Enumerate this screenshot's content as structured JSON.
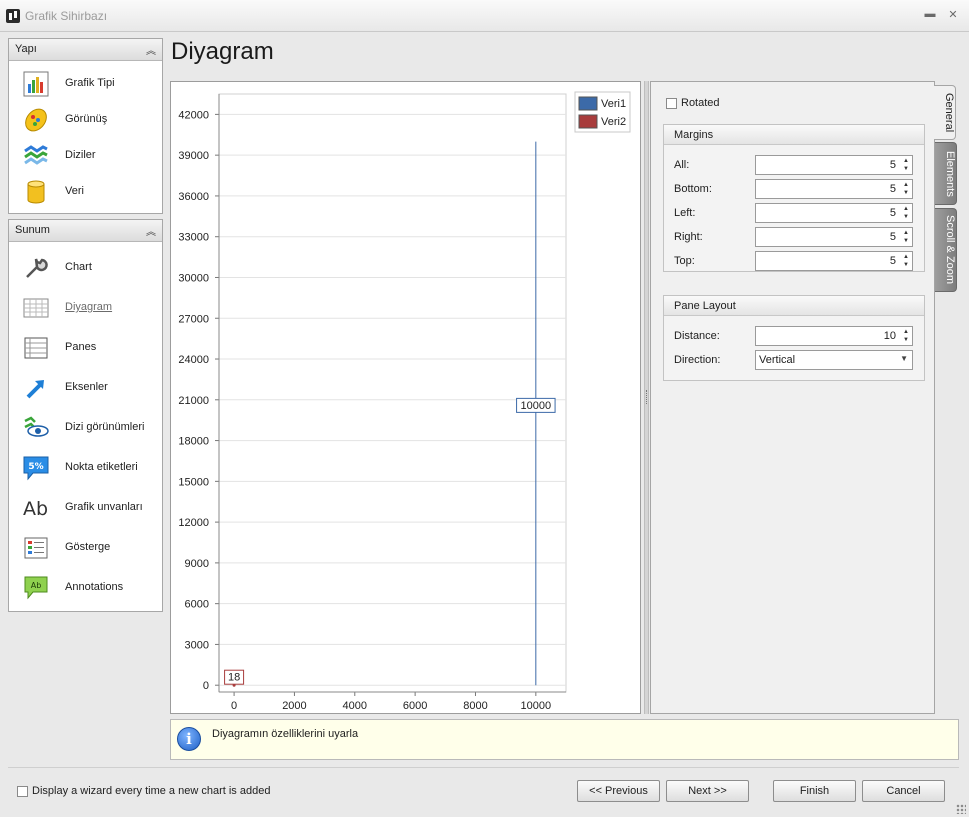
{
  "window": {
    "title": "Grafik Sihirbazı"
  },
  "sidebar": {
    "group1": {
      "title": "Yapı",
      "items": [
        {
          "label": "Grafik Tipi",
          "icon": "bar-chart-icon"
        },
        {
          "label": "Görünüş",
          "icon": "palette-icon"
        },
        {
          "label": "Diziler",
          "icon": "series-stack-icon"
        },
        {
          "label": "Veri",
          "icon": "database-cylinder-icon"
        }
      ]
    },
    "group2": {
      "title": "Sunum",
      "items": [
        {
          "label": "Chart",
          "icon": "wrench-icon"
        },
        {
          "label": "Diyagram",
          "icon": "diagram-grid-icon",
          "active": true
        },
        {
          "label": "Panes",
          "icon": "panes-icon"
        },
        {
          "label": "Eksenler",
          "icon": "axis-arrow-icon"
        },
        {
          "label": "Dizi görünümleri",
          "icon": "series-view-eye-icon"
        },
        {
          "label": "Nokta etiketleri",
          "icon": "point-label-percent-icon"
        },
        {
          "label": "Grafik unvanları",
          "icon": "title-ab-icon"
        },
        {
          "label": "Gösterge",
          "icon": "legend-list-icon"
        },
        {
          "label": "Annotations",
          "icon": "annotation-callout-icon"
        }
      ]
    }
  },
  "page": {
    "title": "Diyagram"
  },
  "chart_data": {
    "type": "line",
    "legend": [
      "Veri1",
      "Veri2"
    ],
    "legend_colors": [
      "#3c6aa8",
      "#a83c3c"
    ],
    "legend_position": "top-right",
    "x_ticks": [
      "0",
      "2000",
      "4000",
      "6000",
      "8000",
      "10000"
    ],
    "y_ticks": [
      "0",
      "3000",
      "6000",
      "9000",
      "12000",
      "15000",
      "18000",
      "21000",
      "24000",
      "27000",
      "30000",
      "33000",
      "36000",
      "39000",
      "42000"
    ],
    "xlim": [
      -500,
      11000
    ],
    "ylim": [
      -500,
      43500
    ],
    "grid": true,
    "series": [
      {
        "name": "Veri1",
        "color": "#3c6aa8",
        "points": [
          [
            10000,
            0
          ],
          [
            10000,
            40000
          ]
        ],
        "label": "10000",
        "label_at": [
          10000,
          20000
        ]
      },
      {
        "name": "Veri2",
        "color": "#a83c3c",
        "points": [
          [
            0,
            0
          ]
        ],
        "label": "18",
        "label_at": [
          0,
          0
        ]
      }
    ]
  },
  "properties": {
    "rotated_label": "Rotated",
    "margins": {
      "title": "Margins",
      "rows": [
        {
          "label": "All:",
          "value": "5"
        },
        {
          "label": "Bottom:",
          "value": "5"
        },
        {
          "label": "Left:",
          "value": "5"
        },
        {
          "label": "Right:",
          "value": "5"
        },
        {
          "label": "Top:",
          "value": "5"
        }
      ]
    },
    "pane_layout": {
      "title": "Pane Layout",
      "distance_label": "Distance:",
      "distance_value": "10",
      "direction_label": "Direction:",
      "direction_value": "Vertical"
    },
    "tabs": [
      "General",
      "Elements",
      "Scroll & Zoom"
    ]
  },
  "hint": {
    "text": "Diyagramın özelliklerini uyarla"
  },
  "footer": {
    "checkbox_label": "Display a wizard every time a new chart is added",
    "buttons": {
      "previous": "<< Previous",
      "next": "Next >>",
      "finish": "Finish",
      "cancel": "Cancel"
    }
  }
}
